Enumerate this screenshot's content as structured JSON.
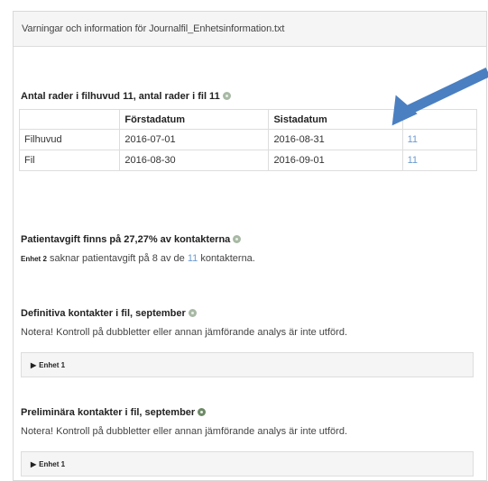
{
  "panel": {
    "heading": "Varningar och information för Journalfil_Enhetsinformation.txt"
  },
  "rows_section": {
    "title": "Antal rader i filhuvud 11, antal rader i fil 11",
    "columns": [
      "",
      "Förstadatum",
      "Sistadatum",
      ""
    ],
    "rows": [
      {
        "label": "Filhuvud",
        "first": "2016-07-01",
        "last": "2016-08-31",
        "count": "11"
      },
      {
        "label": "Fil",
        "first": "2016-08-30",
        "last": "2016-09-01",
        "count": "11"
      }
    ]
  },
  "fee_section": {
    "title": "Patientavgift finns på 27,27% av kontakterna",
    "unit": "Enhet 2",
    "text_before": " saknar patientavgift på 8 av de ",
    "highlight": "11",
    "text_after": " kontakterna."
  },
  "definitive_section": {
    "title": "Definitiva kontakter i fil, september",
    "note": "Notera! Kontroll på dubbletter eller annan jämförande analys är inte utförd.",
    "collapsible": "Enhet 1"
  },
  "preliminary_section": {
    "title": "Preliminära kontakter i fil, september",
    "note": "Notera! Kontroll på dubbletter eller annan jämförande analys är inte utförd.",
    "collapsible": "Enhet 1"
  },
  "colors": {
    "arrow": "#4a7fc1",
    "link": "#6b9bd1",
    "info_icon": "#a8b9a5"
  }
}
